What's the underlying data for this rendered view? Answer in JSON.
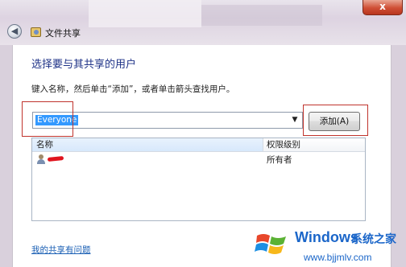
{
  "window": {
    "title": "文件共享",
    "close_glyph": "x",
    "back_glyph": "◀"
  },
  "dialog": {
    "heading": "选择要与其共享的用户",
    "instruction": "键入名称，然后单击“添加”，或者单击箭头查找用户。",
    "name_input_value": "Everyone",
    "dropdown_glyph": "▼",
    "add_button_label": "添加(A)",
    "table": {
      "columns": [
        "名称",
        "权限级别"
      ],
      "rows": [
        {
          "name": "",
          "permission": "所有者"
        }
      ]
    },
    "help_link": "我的共享有问题"
  },
  "watermark": {
    "brand": "Windows",
    "site_name": "系统之家",
    "url": "www.bjjmlv.com"
  },
  "colors": {
    "heading": "#1e3287",
    "selection": "#3399ff",
    "highlight_box": "#c0332c",
    "link": "#1a5fb4"
  }
}
